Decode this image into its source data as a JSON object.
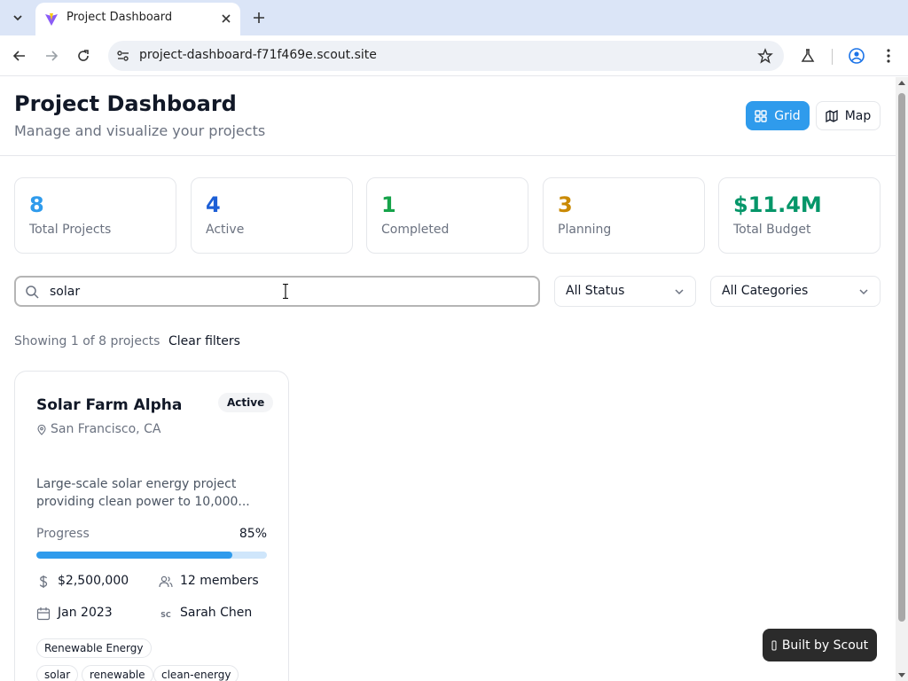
{
  "browser": {
    "tab_title": "Project Dashboard",
    "url": "project-dashboard-f71f469e.scout.site"
  },
  "header": {
    "title": "Project Dashboard",
    "subtitle": "Manage and visualize your projects",
    "view_grid_label": "Grid",
    "view_map_label": "Map",
    "active_view": "Grid"
  },
  "stats": [
    {
      "value": "8",
      "label": "Total Projects",
      "color": "#2f9bec"
    },
    {
      "value": "4",
      "label": "Active",
      "color": "#1d5fd6"
    },
    {
      "value": "1",
      "label": "Completed",
      "color": "#16a34a"
    },
    {
      "value": "3",
      "label": "Planning",
      "color": "#ca8a04"
    },
    {
      "value": "$11.4M",
      "label": "Total Budget",
      "color": "#059669"
    }
  ],
  "filters": {
    "search_value": "solar",
    "status_selected": "All Status",
    "category_selected": "All Categories",
    "results_text": "Showing 1 of 8 projects",
    "clear_label": "Clear filters"
  },
  "projects": [
    {
      "title": "Solar Farm Alpha",
      "status": "Active",
      "location": "San Francisco, CA",
      "description": "Large-scale solar energy project providing clean power to 10,000...",
      "progress_label": "Progress",
      "progress_text": "85%",
      "progress": 0.85,
      "budget": "$2,500,000",
      "members": "12 members",
      "start": "Jan 2023",
      "manager_initials": "SC",
      "manager": "Sarah Chen",
      "category": "Renewable Energy",
      "tags": [
        "solar",
        "renewable",
        "clean-energy"
      ]
    }
  ],
  "footer_badge": {
    "label": "Built by Scout"
  }
}
